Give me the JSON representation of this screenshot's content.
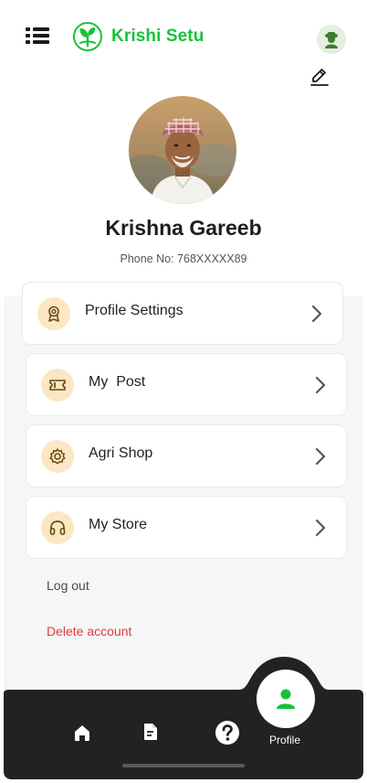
{
  "app": {
    "name": "Krishi Setu",
    "brand_color": "#19c23a",
    "icons": {
      "menu": "menu-icon",
      "logo": "sprout-logo-icon",
      "avatar": "farmer-avatar-icon",
      "edit": "pencil-edit-icon"
    }
  },
  "profile": {
    "name": "Krishna Gareeb",
    "phone": "Phone No: 768XXXXX89"
  },
  "menu": {
    "items": [
      {
        "label": "Profile Settings",
        "icon": "award-badge-icon"
      },
      {
        "label": "My  Post",
        "icon": "ticket-icon"
      },
      {
        "label": "Agri Shop",
        "icon": "gear-icon"
      },
      {
        "label": "My Store",
        "icon": "headphones-icon"
      }
    ],
    "icon_bg_color": "#fbe7c4",
    "icon_color": "#6b4a12"
  },
  "actions": {
    "logout": "Log out",
    "delete": "Delete account",
    "delete_color": "#e23b3b"
  },
  "bottom_nav": {
    "background": "#222222",
    "items": [
      {
        "name": "home",
        "icon": "home-icon"
      },
      {
        "name": "documents",
        "icon": "document-icon"
      },
      {
        "name": "help",
        "icon": "help-icon"
      },
      {
        "name": "profile",
        "icon": "user-icon",
        "label": "Profile",
        "active": true
      }
    ]
  }
}
